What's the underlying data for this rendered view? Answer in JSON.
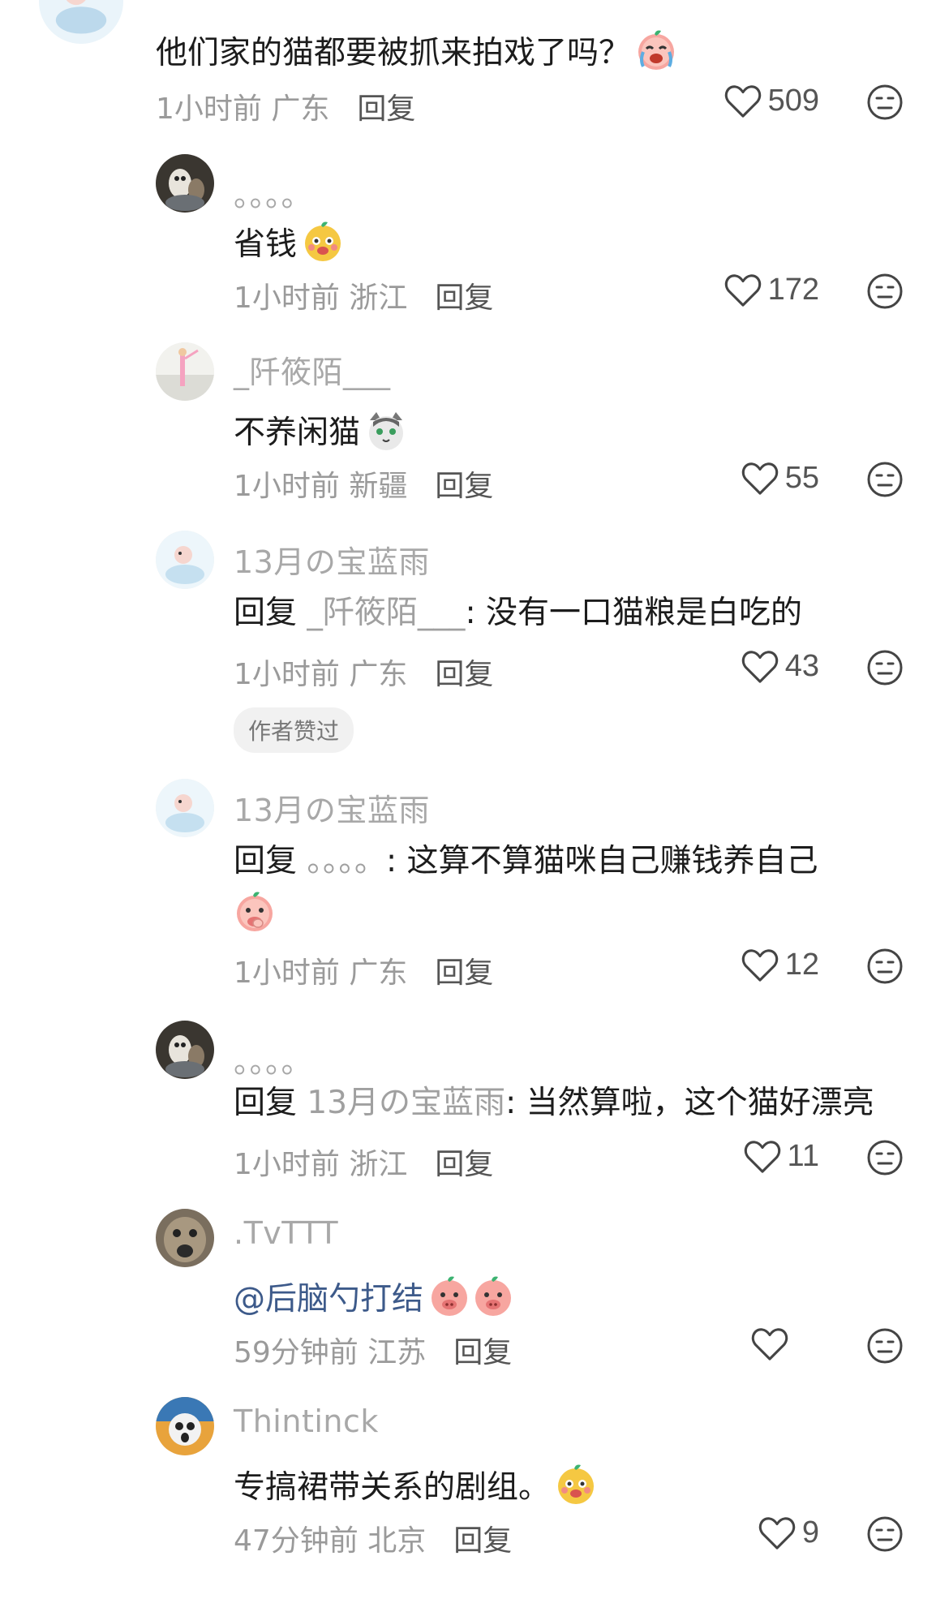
{
  "comments": [
    {
      "text": "他们家的猫都要被抓来拍戏了吗？",
      "meta": "1小时前 广东",
      "reply": "回复",
      "likes": "509",
      "emoji": "crying-pink-face-emoji"
    },
    {
      "username": "。。。。",
      "text": "省钱",
      "meta": "1小时前 浙江",
      "reply": "回复",
      "likes": "172",
      "emoji": "crying-yellow-face-emoji"
    },
    {
      "username": "_阡筱陌___",
      "text": "不养闲猫",
      "meta": "1小时前 新疆",
      "reply": "回复",
      "likes": "55",
      "emoji": "cat-face-emoji"
    },
    {
      "username": "13月の宝蓝雨",
      "prefix": "回复",
      "target": "_阡筱陌___",
      "text": ": 没有一口猫粮是白吃的",
      "meta": "1小时前 广东",
      "reply": "回复",
      "likes": "43",
      "badge": "作者赞过"
    },
    {
      "username": "13月の宝蓝雨",
      "prefix": "回复",
      "target": "。。。。",
      "text": ": 这算不算猫咪自己赚钱养自己",
      "meta": "1小时前 广东",
      "reply": "回复",
      "likes": "12",
      "emoji": "pink-face-covering-mouth-emoji"
    },
    {
      "username": "。。。。",
      "prefix": "回复",
      "target": "13月の宝蓝雨",
      "text": ": 当然算啦，这个猫好漂亮",
      "meta": "1小时前 浙江",
      "reply": "回复",
      "likes": "11"
    },
    {
      "username": ".TvTTT",
      "mention": "@后脑勺打结",
      "meta": "59分钟前 江苏",
      "reply": "回复",
      "likes": "",
      "emoji": "pig-face-emoji"
    },
    {
      "username": "Thintinck",
      "text": "专搞裙带关系的剧组。",
      "meta": "47分钟前 北京",
      "reply": "回复",
      "likes": "9",
      "emoji": "crying-yellow-face-emoji"
    }
  ],
  "colors": {
    "text": "#1c1c1c",
    "muted": "#9a9a9a",
    "username": "#a8a8a8",
    "mention": "#3d5a8a",
    "badge_bg": "#f1f1f1"
  },
  "icons": {
    "like": "heart-outline-icon",
    "dislike": "neutral-face-icon"
  }
}
